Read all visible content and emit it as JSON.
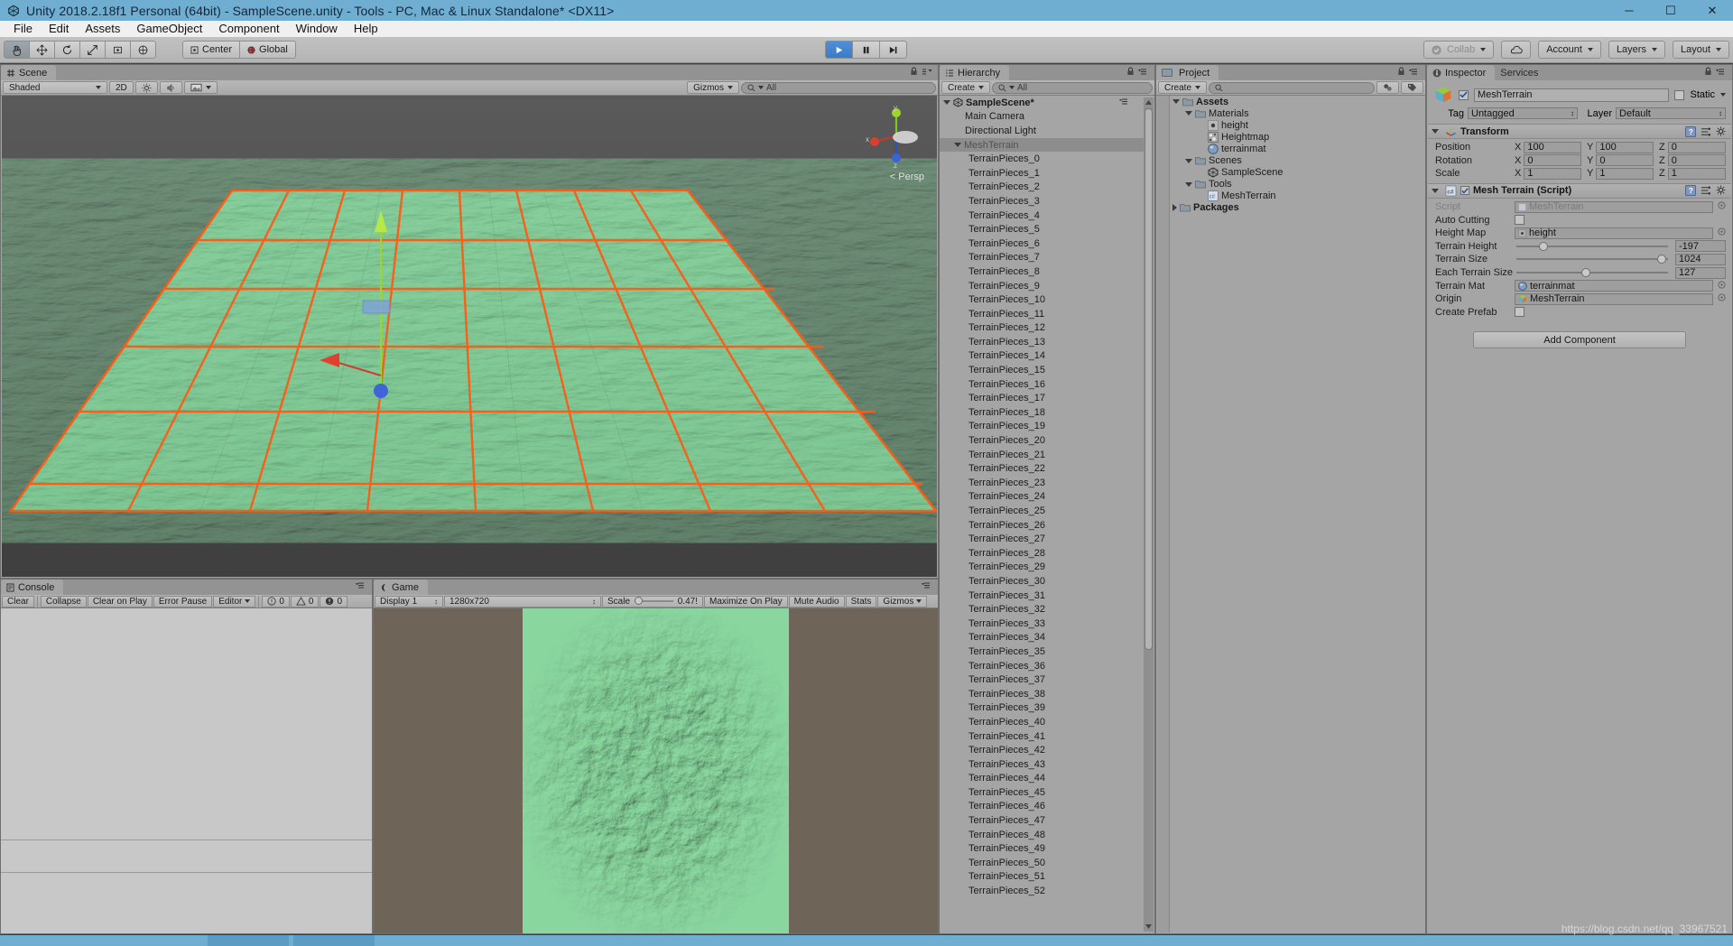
{
  "window": {
    "title": "Unity 2018.2.18f1 Personal (64bit) - SampleScene.unity - Tools - PC, Mac & Linux Standalone* <DX11>",
    "minimize": "─",
    "maximize": "☐",
    "close": "✕",
    "icon": "unity-logo-icon"
  },
  "menubar": {
    "items": [
      "File",
      "Edit",
      "Assets",
      "GameObject",
      "Component",
      "Window",
      "Help"
    ]
  },
  "toolbar": {
    "tools": [
      "hand-tool",
      "move-tool",
      "rotate-tool",
      "scale-tool",
      "rect-tool",
      "transform-tool"
    ],
    "selected_tool_index": 0,
    "pivot_label": "Center",
    "space_label": "Global",
    "play_label": "play-icon",
    "pause_label": "pause-icon",
    "step_label": "step-icon",
    "collab_label": "Collab",
    "cloud_label": "cloud-icon",
    "account_label": "Account",
    "layers_label": "Layers",
    "layout_label": "Layout"
  },
  "scene": {
    "tab_label": "Scene",
    "shading_label": "Shaded",
    "mode_2d_label": "2D",
    "gizmos_label": "Gizmos",
    "search_placeholder": "All",
    "persp_label": "Persp",
    "axis_x": "x",
    "axis_y": "y",
    "axis_z": "z"
  },
  "hierarchy": {
    "tab_label": "Hierarchy",
    "create_label": "Create",
    "search_value": "All",
    "scene_root": "SampleScene*",
    "items": [
      {
        "label": "Main Camera",
        "depth": 1,
        "selected": false,
        "expandable": false
      },
      {
        "label": "Directional Light",
        "depth": 1,
        "selected": false,
        "expandable": false
      },
      {
        "label": "MeshTerrain",
        "depth": 1,
        "selected": true,
        "expandable": true
      }
    ],
    "children_prefix": "TerrainPieces_",
    "children_start": 0,
    "children_end": 52
  },
  "project": {
    "tab_label": "Project",
    "create_label": "Create",
    "search_placeholder": "",
    "tree": [
      {
        "label": "Assets",
        "depth": 0,
        "icon": "folder-icon",
        "bold": true,
        "arrow": "down"
      },
      {
        "label": "Materials",
        "depth": 1,
        "icon": "folder-icon",
        "bold": false,
        "arrow": "down"
      },
      {
        "label": "height",
        "depth": 2,
        "icon": "texture-icon",
        "bold": false,
        "arrow": "none"
      },
      {
        "label": "Heightmap",
        "depth": 2,
        "icon": "noise-icon",
        "bold": false,
        "arrow": "none"
      },
      {
        "label": "terrainmat",
        "depth": 2,
        "icon": "material-icon",
        "bold": false,
        "arrow": "none"
      },
      {
        "label": "Scenes",
        "depth": 1,
        "icon": "folder-icon",
        "bold": false,
        "arrow": "down"
      },
      {
        "label": "SampleScene",
        "depth": 2,
        "icon": "unity-icon",
        "bold": false,
        "arrow": "none"
      },
      {
        "label": "Tools",
        "depth": 1,
        "icon": "folder-icon",
        "bold": false,
        "arrow": "down"
      },
      {
        "label": "MeshTerrain",
        "depth": 2,
        "icon": "csharp-icon",
        "bold": false,
        "arrow": "none"
      },
      {
        "label": "Packages",
        "depth": 0,
        "icon": "folder-icon",
        "bold": true,
        "arrow": "right"
      }
    ]
  },
  "inspector": {
    "tab_label": "Inspector",
    "services_tab_label": "Services",
    "object_name": "MeshTerrain",
    "object_enabled": true,
    "static_label": "Static",
    "static_checked": false,
    "tag_label": "Tag",
    "tag_value": "Untagged",
    "layer_label": "Layer",
    "layer_value": "Default",
    "transform": {
      "title": "Transform",
      "rows": [
        {
          "label": "Position",
          "x": "100",
          "y": "100",
          "z": "0"
        },
        {
          "label": "Rotation",
          "x": "0",
          "y": "0",
          "z": "0"
        },
        {
          "label": "Scale",
          "x": "1",
          "y": "1",
          "z": "1"
        }
      ]
    },
    "script_component": {
      "title": "Mesh Terrain (Script)",
      "enabled": true,
      "script_label": "Script",
      "script_value": "MeshTerrain",
      "fields": [
        {
          "label": "Auto Cutting",
          "type": "checkbox",
          "checked": false
        },
        {
          "label": "Height Map",
          "type": "object",
          "value": "height",
          "icon": "texture-icon"
        },
        {
          "label": "Terrain Height",
          "type": "slider",
          "value": "-197",
          "percent": 18
        },
        {
          "label": "Terrain Size",
          "type": "slider",
          "value": "1024",
          "percent": 96
        },
        {
          "label": "Each Terrain Size",
          "type": "slider",
          "value": "127",
          "percent": 46
        },
        {
          "label": "Terrain Mat",
          "type": "object",
          "value": "terrainmat",
          "icon": "material-icon"
        },
        {
          "label": "Origin",
          "type": "object",
          "value": "MeshTerrain",
          "icon": "prefab-icon"
        },
        {
          "label": "Create Prefab",
          "type": "checkbox",
          "checked": false
        }
      ]
    },
    "add_component_label": "Add Component"
  },
  "console": {
    "tab_label": "Console",
    "buttons": [
      "Clear",
      "Collapse",
      "Clear on Play",
      "Error Pause"
    ],
    "editor_label": "Editor",
    "counts": {
      "info": "0",
      "warning": "0",
      "error": "0"
    }
  },
  "game": {
    "tab_label": "Game",
    "display_label": "Display 1",
    "resolution_label": "1280x720",
    "scale_label": "Scale",
    "scale_value": "0.47!",
    "maximize_label": "Maximize On Play",
    "mute_label": "Mute Audio",
    "stats_label": "Stats",
    "gizmos_label": "Gizmos"
  },
  "watermark": {
    "text": "https://blog.csdn.net/qq_33967521"
  },
  "colors": {
    "title_bar": "#70aed1",
    "panel_bg": "#a5a5a5",
    "terrain_green": "#7fcc96",
    "terrain_outline": "#ff5a14",
    "selection": "#8d8d8d"
  }
}
